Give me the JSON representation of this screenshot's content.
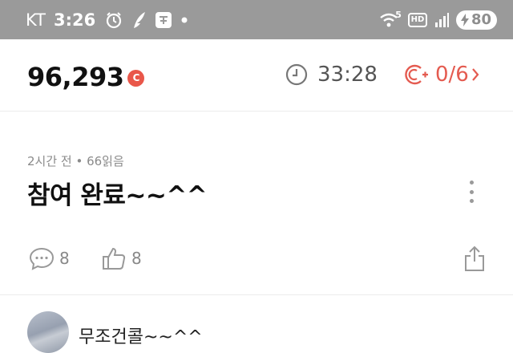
{
  "status_bar": {
    "carrier": "KT",
    "time": "3:26",
    "battery_level": "80",
    "indicator_label": "HD",
    "wifi_generation": "5",
    "icons": [
      "alarm-icon",
      "feather-icon",
      "app-badge-icon",
      "dot-icon",
      "wifi-icon",
      "hd-icon",
      "signal-icon",
      "battery-charging-icon"
    ]
  },
  "header": {
    "points": "96,293",
    "coin_label": "C",
    "timer": "33:28",
    "mission_progress": "0/6"
  },
  "post": {
    "meta": "2시간 전 • 66읽음",
    "title": "참여 완료~~^^",
    "comment_count": "8",
    "like_count": "8"
  },
  "comment": {
    "text": "무조건콜~~^^"
  },
  "colors": {
    "status_bar_bg": "#9a9a9a",
    "accent_red": "#e45b50",
    "muted_gray": "#8a8a8a"
  }
}
